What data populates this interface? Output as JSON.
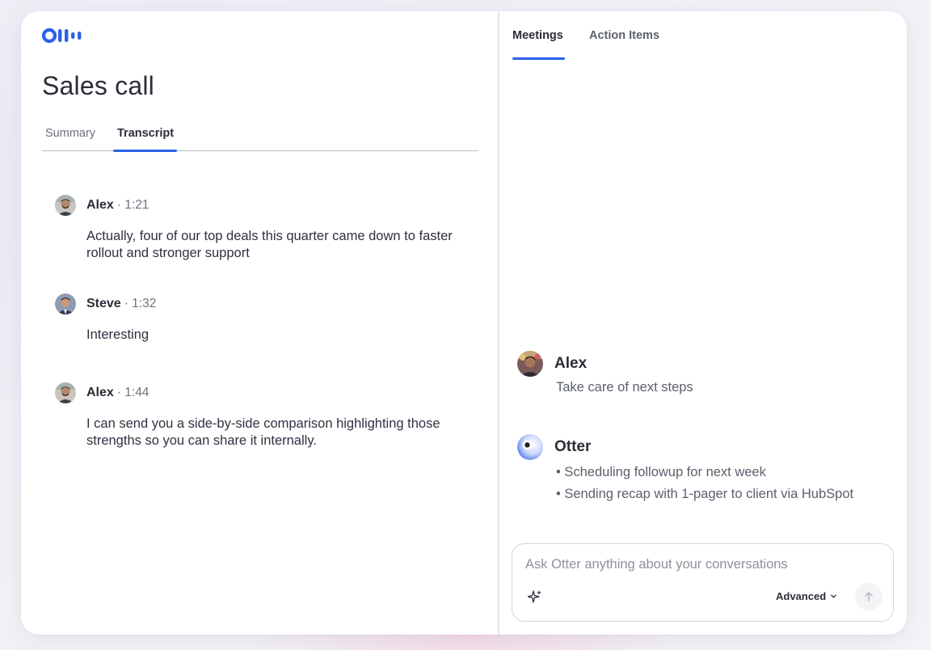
{
  "app": {
    "logo_icon": "otter-logo-icon",
    "brand_color": "#2c61e8"
  },
  "left": {
    "title": "Sales call",
    "tabs": [
      {
        "label": "Summary",
        "active": false
      },
      {
        "label": "Transcript",
        "active": true
      }
    ],
    "transcript": [
      {
        "speaker": "Alex",
        "time": "· 1:21",
        "text": "Actually, four of our top deals this quarter came down to faster rollout and stronger support",
        "avatar": "avatar-alex"
      },
      {
        "speaker": "Steve",
        "time": "· 1:32",
        "text": "Interesting",
        "avatar": "avatar-steve"
      },
      {
        "speaker": "Alex",
        "time": "· 1:44",
        "text": "I can send you a side-by-side comparison highlighting those strengths so you can share it internally.",
        "avatar": "avatar-alex"
      }
    ]
  },
  "right": {
    "tabs": [
      {
        "label": "Meetings",
        "active": true
      },
      {
        "label": "Action Items",
        "active": false
      }
    ],
    "messages": [
      {
        "sender": "Alex",
        "text": "Take care of next steps"
      },
      {
        "sender": "Otter",
        "bullets": [
          "Scheduling followup for next week",
          "Sending recap with 1-pager to client via HubSpot"
        ]
      }
    ],
    "ask": {
      "placeholder": "Ask Otter anything about your conversations",
      "value": "",
      "mode_label": "Advanced",
      "sparkle_icon": "sparkle-icon",
      "send_icon": "arrow-up-icon"
    }
  }
}
